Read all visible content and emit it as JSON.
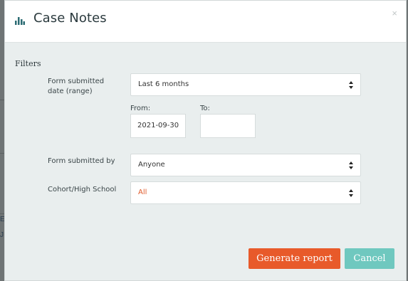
{
  "background": {
    "fragments": [
      "E",
      "J"
    ]
  },
  "modal": {
    "title": "Case Notes",
    "title_icon": "bar-chart-icon",
    "close_symbol": "×",
    "section_label": "Filters",
    "fields": {
      "date_range": {
        "label_line1": "Form submitted",
        "label_line2": "date (range)",
        "value": "Last 6 months",
        "from_label": "From:",
        "from_value": "2021-09-30",
        "to_label": "To:",
        "to_value": ""
      },
      "submitted_by": {
        "label": "Form submitted by",
        "value": "Anyone"
      },
      "cohort": {
        "label": "Cohort/High School",
        "value": "All"
      }
    },
    "buttons": {
      "generate": "Generate report",
      "cancel": "Cancel"
    }
  },
  "colors": {
    "accent_orange": "#e85a2a",
    "cancel_teal": "#6fc8bf",
    "title_icon": "#2b6b73"
  }
}
